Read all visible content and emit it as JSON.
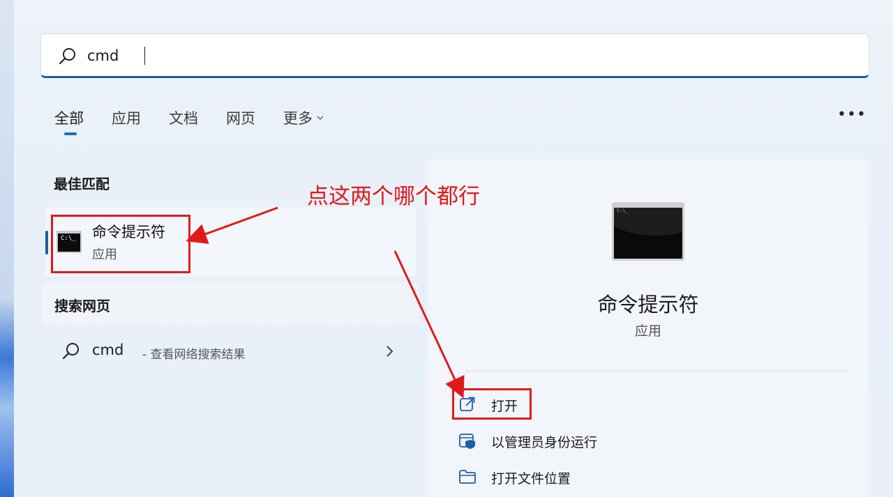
{
  "search": {
    "query": "cmd"
  },
  "tabs": [
    {
      "label": "全部",
      "active": true
    },
    {
      "label": "应用",
      "active": false
    },
    {
      "label": "文档",
      "active": false
    },
    {
      "label": "网页",
      "active": false
    },
    {
      "label": "更多",
      "active": false
    }
  ],
  "best_match": {
    "heading": "最佳匹配",
    "title": "命令提示符",
    "subtitle": "应用",
    "icon_text": "C:\\_"
  },
  "web_search": {
    "heading": "搜索网页",
    "term": "cmd",
    "description": "- 查看网络搜索结果"
  },
  "detail": {
    "title": "命令提示符",
    "subtitle": "应用",
    "actions": [
      {
        "label": "打开",
        "icon": "open-external-icon"
      },
      {
        "label": "以管理员身份运行",
        "icon": "shield-admin-icon"
      },
      {
        "label": "打开文件位置",
        "icon": "folder-icon"
      }
    ]
  },
  "annotation": {
    "text": "点这两个哪个都行",
    "color": "#e01a1a"
  },
  "colors": {
    "accent": "#1a5ea8",
    "annotation": "#e01a1a",
    "panel": "#f2f5f9"
  }
}
